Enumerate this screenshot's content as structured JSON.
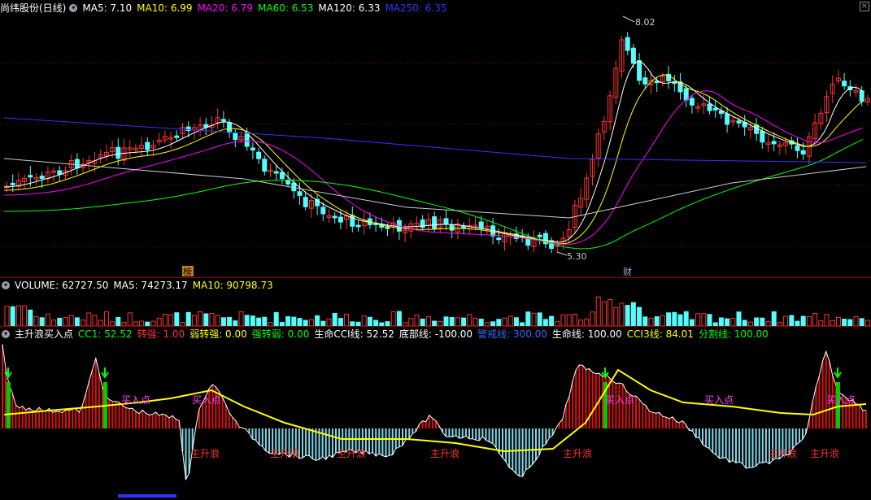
{
  "header": {
    "title": "尚纬股份(日线)",
    "ma": [
      {
        "label": "MA5: 7.10",
        "color": "#ffffff"
      },
      {
        "label": "MA10: 6.99",
        "color": "#ffff00"
      },
      {
        "label": "MA20: 6.79",
        "color": "#ff00ff"
      },
      {
        "label": "MA60: 6.53",
        "color": "#00ff00"
      },
      {
        "label": "MA120: 6.33",
        "color": "#ffffff"
      },
      {
        "label": "MA250: 6.35",
        "color": "#3333ff"
      }
    ],
    "high_label": "8.02",
    "low_label": "5.30",
    "marker_left": "榜",
    "marker_right": "财"
  },
  "volume": {
    "items": [
      {
        "label": "VOLUME: 62727.50",
        "color": "#ffffff"
      },
      {
        "label": "MA5: 74273.17",
        "color": "#ffffff"
      },
      {
        "label": "MA10: 90798.73",
        "color": "#ffff00"
      }
    ]
  },
  "indicator": {
    "title": "主升浪买入点",
    "items": [
      {
        "label": "CC1: 52.52",
        "color": "#00ff00"
      },
      {
        "label": "转强: 1.00",
        "color": "#ff3030"
      },
      {
        "label": "弱转强: 0.00",
        "color": "#ffff00"
      },
      {
        "label": "强转弱: 0.00",
        "color": "#00ff00"
      },
      {
        "label": "生命CCI线: 52.52",
        "color": "#ffffff"
      },
      {
        "label": "底部线: -100.00",
        "color": "#ffffff"
      },
      {
        "label": "警戒线: 300.00",
        "color": "#3366ff"
      },
      {
        "label": "生命线: 100.00",
        "color": "#ffffff"
      },
      {
        "label": "CCI3线: 84.01",
        "color": "#ffff00"
      },
      {
        "label": "分割线: 100.00",
        "color": "#00ff00"
      }
    ],
    "buy_label": "买入点",
    "wave_label": "主升浪",
    "buy_positions": [
      163,
      250,
      758,
      880,
      1030
    ],
    "wave_positions": [
      250,
      348,
      430,
      545,
      708,
      960,
      1012
    ]
  },
  "colors": {
    "up": "#ff3232",
    "down": "#54fcfc",
    "grid": "#8b0000"
  }
}
